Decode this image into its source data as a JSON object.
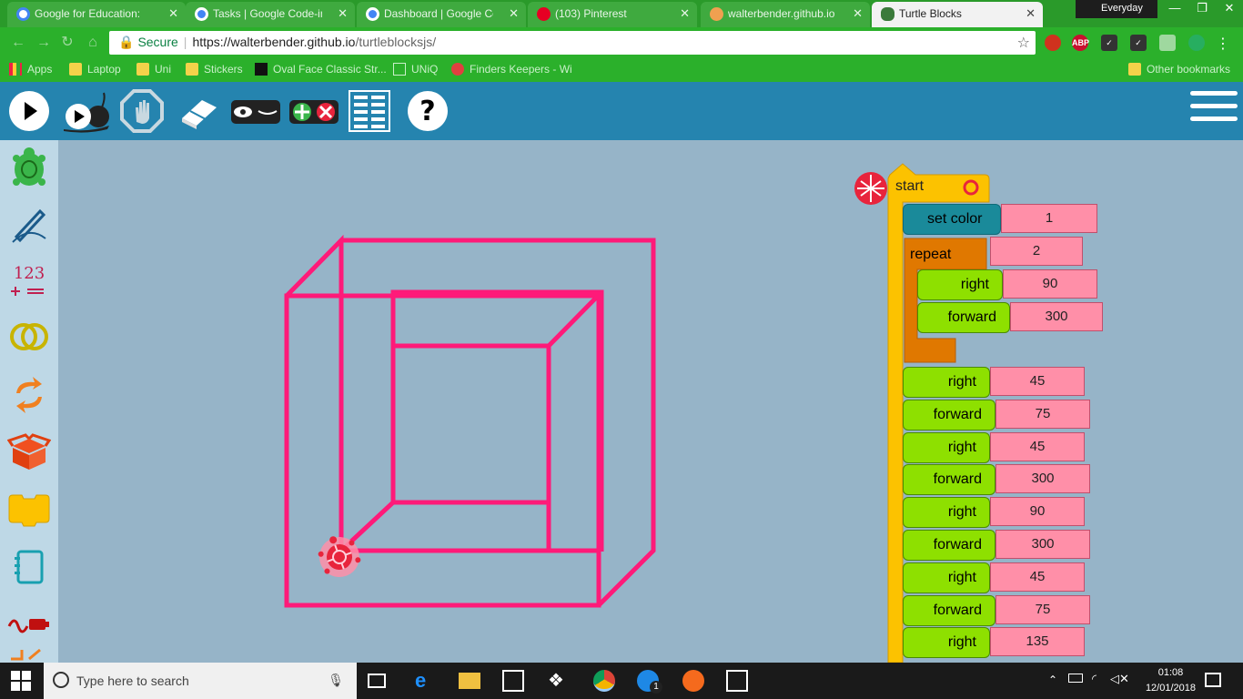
{
  "browser": {
    "tabs": [
      {
        "title": "Google for Education: F",
        "active": false
      },
      {
        "title": "Tasks | Google Code-in",
        "active": false
      },
      {
        "title": "Dashboard | Google Co",
        "active": false
      },
      {
        "title": "(103) Pinterest",
        "active": false
      },
      {
        "title": "walterbender.github.io",
        "active": false
      },
      {
        "title": "Turtle Blocks",
        "active": true
      }
    ],
    "profile_name": "Everyday",
    "secure_label": "Secure",
    "url_host": "https://walterbender.github.io",
    "url_path": "/turtleblocksjs/",
    "extensions": [
      "ABP"
    ],
    "bookmarks": [
      {
        "label": "Apps"
      },
      {
        "label": "Laptop"
      },
      {
        "label": "Uni"
      },
      {
        "label": "Stickers"
      },
      {
        "label": "Oval Face Classic Str..."
      },
      {
        "label": "UNiQ"
      },
      {
        "label": "Finders Keepers - Wi"
      }
    ],
    "other_bookmarks": "Other bookmarks"
  },
  "toolbar": {
    "icons": [
      "play-icon",
      "slow-run-icon",
      "stop-icon",
      "erase-icon",
      "hide-blocks-icon",
      "collapse-expand-icon",
      "grid-icon",
      "help-icon",
      "menu-icon"
    ]
  },
  "palette": {
    "icons": [
      "turtle-icon",
      "pen-icon",
      "number-icon",
      "boolean-icon",
      "flow-icon",
      "box-icon",
      "action-icon",
      "media-icon",
      "sensors-icon",
      "extras-icon"
    ],
    "number_label": "123"
  },
  "program": {
    "start_label": "start",
    "set_color": {
      "label": "set color",
      "value": "1"
    },
    "repeat": {
      "label": "repeat",
      "value": "2"
    },
    "repeat_body": [
      {
        "label": "right",
        "value": "90"
      },
      {
        "label": "forward",
        "value": "300"
      }
    ],
    "after": [
      {
        "label": "right",
        "value": "45"
      },
      {
        "label": "forward",
        "value": "75"
      },
      {
        "label": "right",
        "value": "45"
      },
      {
        "label": "forward",
        "value": "300"
      },
      {
        "label": "right",
        "value": "90"
      },
      {
        "label": "forward",
        "value": "300"
      },
      {
        "label": "right",
        "value": "45"
      },
      {
        "label": "forward",
        "value": "75"
      },
      {
        "label": "right",
        "value": "135"
      }
    ]
  },
  "drawing": {
    "pen_color": "#ff1a79"
  },
  "taskbar": {
    "search_placeholder": "Type here to search",
    "time": "01:08",
    "date": "12/01/2018",
    "messenger_badge": "1"
  }
}
